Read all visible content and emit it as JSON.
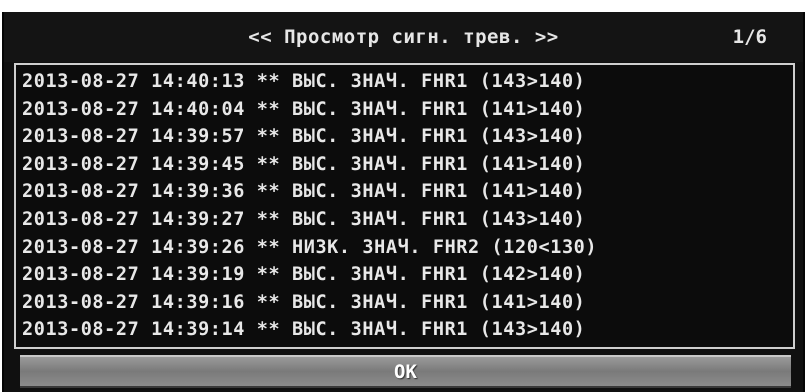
{
  "window": {
    "title": "<< Просмотр сигн. трев. >>",
    "page_indicator": "1/6"
  },
  "log": {
    "rows": [
      "2013-08-27 14:40:13 ** ВЫС. ЗНАЧ. FHR1 (143>140)",
      "2013-08-27 14:40:04 ** ВЫС. ЗНАЧ. FHR1 (141>140)",
      "2013-08-27 14:39:57 ** ВЫС. ЗНАЧ. FHR1 (143>140)",
      "2013-08-27 14:39:45 ** ВЫС. ЗНАЧ. FHR1 (141>140)",
      "2013-08-27 14:39:36 ** ВЫС. ЗНАЧ. FHR1 (141>140)",
      "2013-08-27 14:39:27 ** ВЫС. ЗНАЧ. FHR1 (143>140)",
      "2013-08-27 14:39:26 ** НИЗК. ЗНАЧ. FHR2 (120<130)",
      "2013-08-27 14:39:19 ** ВЫС. ЗНАЧ. FHR1 (142>140)",
      "2013-08-27 14:39:16 ** ВЫС. ЗНАЧ. FHR1 (141>140)",
      "2013-08-27 14:39:14 ** ВЫС. ЗНАЧ. FHR1 (143>140)"
    ]
  },
  "footer": {
    "ok_label": "OK"
  },
  "colors": {
    "background": "#101010",
    "text": "#e8e8e8",
    "panel_border": "#cfcfcf",
    "button": "#8a8a8a"
  }
}
